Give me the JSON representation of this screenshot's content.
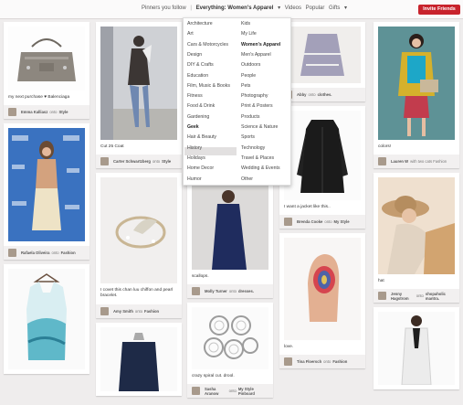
{
  "header": {
    "label": "Pinners you follow",
    "category": "Everything: Women's Apparel",
    "videos": "Videos",
    "popular": "Popular",
    "gifts": "Gifts",
    "invite": "Invite Friends"
  },
  "menu": {
    "left": [
      "Architecture",
      "Art",
      "Cars & Motorcycles",
      "Design",
      "DIY & Crafts",
      "Education",
      "Film, Music & Books",
      "Fitness",
      "Food & Drink",
      "Gardening",
      "Geek",
      "Hair & Beauty",
      "History",
      "Holidays",
      "Home Decor",
      "Humor"
    ],
    "right": [
      "Kids",
      "My Life",
      "Women's Apparel",
      "Men's Apparel",
      "Outdoors",
      "People",
      "Pets",
      "Photography",
      "Print & Posters",
      "Products",
      "Science & Nature",
      "Sports",
      "Technology",
      "Travel & Places",
      "Wedding & Events",
      "Other"
    ],
    "highlighted": "Geek"
  },
  "pins": {
    "c1": [
      {
        "desc": "my next purchase ♥ Balenciaga",
        "user": "Emma Kalliasz",
        "board": "Style"
      },
      {
        "desc": "",
        "user": "Rafaela Oliveira",
        "board": "Fashion"
      },
      {
        "desc": "",
        "user": "",
        "board": ""
      }
    ],
    "c2": [
      {
        "desc": "Cut 25 Coat",
        "user": "Carter Schwartzberg",
        "board": "Style"
      },
      {
        "desc": "I covet this chan luu chiffon and pearl bracelet.",
        "user": "Amy Smith",
        "board": "Fashion"
      },
      {
        "desc": "",
        "user": "",
        "board": ""
      }
    ],
    "c3": [
      {
        "desc": "scallops.",
        "user": "Molly Turner",
        "board": "dresses."
      },
      {
        "desc": "crazy spiral cut. drool.",
        "user": "Sasha Aranow",
        "board": "My Style Pinboard"
      }
    ],
    "c4": [
      {
        "desc": "",
        "user": "Abby",
        "board": "clothes."
      },
      {
        "desc": "I want a jacket like this..",
        "user": "Brenda Cooke",
        "board": "My Style"
      },
      {
        "desc": "love.",
        "user": "Tina Floersch",
        "board": "Fashion"
      }
    ],
    "c5": [
      {
        "desc": "colors!",
        "user": "Lauren W",
        "board": "with two cats Fashion"
      },
      {
        "desc": "hat",
        "user": "Jenny Hagstrom",
        "board": "shopaholic mantra."
      },
      {
        "desc": "",
        "user": "",
        "board": ""
      }
    ]
  },
  "connector": "onto",
  "colors": {
    "brand": "#c8232c",
    "background": "#efeded"
  }
}
